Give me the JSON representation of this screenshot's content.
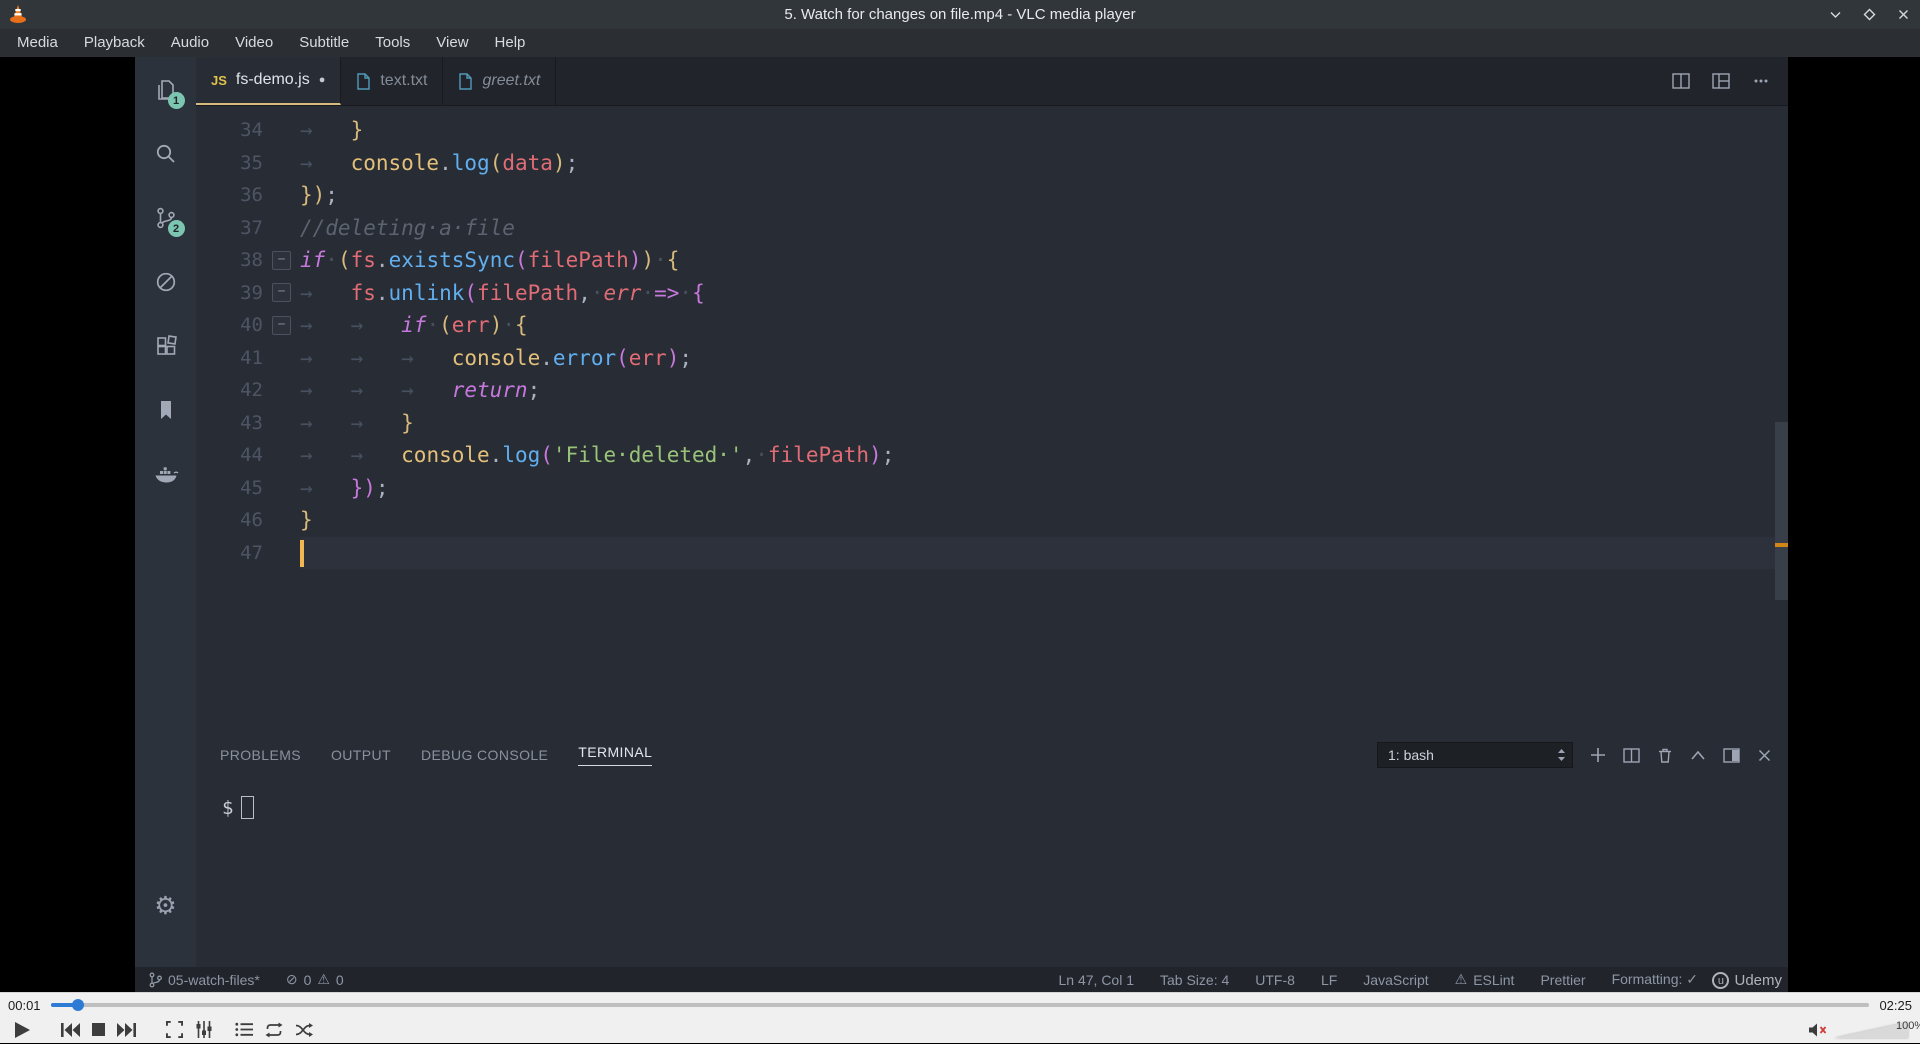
{
  "icons": {
    "gear": "⚙",
    "modified_dot": "●"
  },
  "vlc": {
    "title": "5. Watch for changes on file.mp4 - VLC media player",
    "menu": [
      "Media",
      "Playback",
      "Audio",
      "Video",
      "Subtitle",
      "Tools",
      "View",
      "Help"
    ],
    "time_current": "00:01",
    "time_total": "02:25",
    "volume": "100%"
  },
  "vscode": {
    "activity": {
      "explorer_badge": "1",
      "scm_badge": "2"
    },
    "tabs": [
      {
        "label": "fs-demo.js",
        "icon": "js",
        "modified": true,
        "active": true
      },
      {
        "label": "text.txt",
        "icon": "file"
      },
      {
        "label": "greet.txt",
        "icon": "file",
        "preview": true
      }
    ],
    "editor": {
      "lines": [
        {
          "n": "34",
          "segs": [
            [
              "ws",
              "→   "
            ],
            [
              "gold",
              "}"
            ]
          ]
        },
        {
          "n": "35",
          "segs": [
            [
              "ws",
              "→   "
            ],
            [
              "yellow",
              "console"
            ],
            [
              "fg",
              "."
            ],
            [
              "blue",
              "log"
            ],
            [
              "gold",
              "("
            ],
            [
              "red",
              "data"
            ],
            [
              "gold",
              ")"
            ],
            [
              "fg",
              ";"
            ]
          ]
        },
        {
          "n": "36",
          "segs": [
            [
              "gold",
              "})"
            ],
            [
              "fg",
              ";"
            ]
          ]
        },
        {
          "n": "37",
          "segs": [
            [
              "comment",
              "//deleting·a·file"
            ]
          ]
        },
        {
          "n": "38",
          "fold": true,
          "segs": [
            [
              "purplei",
              "if"
            ],
            [
              "ws",
              "·"
            ],
            [
              "gold",
              "("
            ],
            [
              "red",
              "fs"
            ],
            [
              "fg",
              "."
            ],
            [
              "blue",
              "existsSync"
            ],
            [
              "purple",
              "("
            ],
            [
              "red",
              "filePath"
            ],
            [
              "purple",
              ")"
            ],
            [
              "gold",
              ")"
            ],
            [
              "ws",
              "·"
            ],
            [
              "gold",
              "{"
            ]
          ]
        },
        {
          "n": "39",
          "fold": true,
          "segs": [
            [
              "ws",
              "→   "
            ],
            [
              "red",
              "fs"
            ],
            [
              "fg",
              "."
            ],
            [
              "blue",
              "unlink"
            ],
            [
              "purple",
              "("
            ],
            [
              "red",
              "filePath"
            ],
            [
              "fg",
              ","
            ],
            [
              "ws",
              "·"
            ],
            [
              "redi",
              "err"
            ],
            [
              "ws",
              "·"
            ],
            [
              "purple",
              "=>"
            ],
            [
              "ws",
              "·"
            ],
            [
              "purple",
              "{"
            ]
          ]
        },
        {
          "n": "40",
          "fold": true,
          "segs": [
            [
              "ws",
              "→   →   "
            ],
            [
              "purplei",
              "if"
            ],
            [
              "ws",
              "·"
            ],
            [
              "gold",
              "("
            ],
            [
              "red",
              "err"
            ],
            [
              "gold",
              ")"
            ],
            [
              "ws",
              "·"
            ],
            [
              "gold",
              "{"
            ]
          ]
        },
        {
          "n": "41",
          "segs": [
            [
              "ws",
              "→   →   →   "
            ],
            [
              "yellow",
              "console"
            ],
            [
              "fg",
              "."
            ],
            [
              "blue",
              "error"
            ],
            [
              "purple",
              "("
            ],
            [
              "red",
              "err"
            ],
            [
              "purple",
              ")"
            ],
            [
              "fg",
              ";"
            ]
          ]
        },
        {
          "n": "42",
          "segs": [
            [
              "ws",
              "→   →   →   "
            ],
            [
              "purplei",
              "return"
            ],
            [
              "fg",
              ";"
            ]
          ]
        },
        {
          "n": "43",
          "segs": [
            [
              "ws",
              "→   →   "
            ],
            [
              "gold",
              "}"
            ]
          ]
        },
        {
          "n": "44",
          "segs": [
            [
              "ws",
              "→   →   "
            ],
            [
              "yellow",
              "console"
            ],
            [
              "fg",
              "."
            ],
            [
              "blue",
              "log"
            ],
            [
              "purple",
              "("
            ],
            [
              "green",
              "'File·deleted·'"
            ],
            [
              "fg",
              ","
            ],
            [
              "ws",
              "·"
            ],
            [
              "red",
              "filePath"
            ],
            [
              "purple",
              ")"
            ],
            [
              "fg",
              ";"
            ]
          ]
        },
        {
          "n": "45",
          "segs": [
            [
              "ws",
              "→   "
            ],
            [
              "purple",
              "})"
            ],
            [
              "fg",
              ";"
            ]
          ]
        },
        {
          "n": "46",
          "segs": [
            [
              "gold",
              "}"
            ]
          ]
        },
        {
          "n": "47",
          "cursor": true,
          "segs": []
        }
      ]
    },
    "panel": {
      "tabs": [
        "PROBLEMS",
        "OUTPUT",
        "DEBUG CONSOLE",
        "TERMINAL"
      ],
      "active_tab": "TERMINAL",
      "shell": "1: bash",
      "prompt": "$"
    },
    "status": {
      "branch": "05-watch-files*",
      "error_icon": "⊘",
      "errors": "0",
      "warning_icon": "⚠",
      "warnings": "0",
      "right": [
        {
          "label": "Ln 47, Col 1"
        },
        {
          "label": "Tab Size: 4"
        },
        {
          "label": "UTF-8"
        },
        {
          "label": "LF"
        },
        {
          "label": "JavaScript"
        },
        {
          "label": "ESLint",
          "icon": "⚠"
        },
        {
          "label": "Prettier"
        },
        {
          "label": "Formatting: ✓"
        }
      ]
    },
    "watermark": "Udemy",
    "watermark_logo": "u"
  }
}
